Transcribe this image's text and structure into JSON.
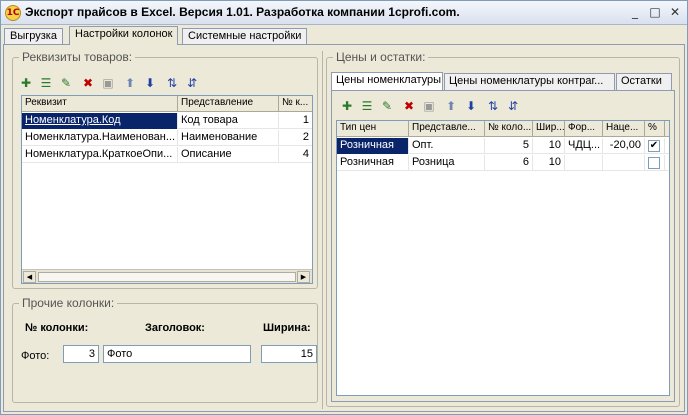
{
  "window": {
    "title": "Экспорт прайсов в Excel. Версия 1.01. Разработка компании 1cprofi.com.",
    "icon": "1c-logo-icon",
    "controls": [
      "_",
      "□",
      "✕"
    ]
  },
  "tabs": [
    {
      "label": "Выгрузка",
      "active": false
    },
    {
      "label": "Настройки колонок",
      "active": true
    },
    {
      "label": "Системные настройки",
      "active": false
    }
  ],
  "attributes_group": {
    "title": "Реквизиты товаров:",
    "toolbar": [
      "add-icon",
      "add-child-icon",
      "edit-icon",
      "delete-icon",
      "disabled-icon",
      "move-up-icon",
      "move-down-icon",
      "sort-asc-icon",
      "sort-desc-icon"
    ],
    "columns": [
      "Реквизит",
      "Представление",
      "№ к...",
      ""
    ],
    "rows": [
      {
        "attr": "Номенклатура.Код",
        "view": "Код товара",
        "num": "1",
        "selected": true
      },
      {
        "attr": "Номенклатура.Наименован...",
        "view": "Наименование",
        "num": "2",
        "selected": false
      },
      {
        "attr": "Номенклатура.КраткоеОпи...",
        "view": "Описание",
        "num": "4",
        "selected": false
      }
    ]
  },
  "other_group": {
    "title": "Прочие колонки:",
    "headers": {
      "num": "№ колонки:",
      "title": "Заголовок:",
      "width": "Ширина:"
    },
    "row": {
      "label": "Фото:",
      "num": "3",
      "title": "Фото",
      "width": "15"
    }
  },
  "prices_group": {
    "title": "Цены и остатки:",
    "tabs": [
      {
        "label": "Цены номенклатуры",
        "active": true
      },
      {
        "label": "Цены номенклатуры контраг...",
        "active": false
      },
      {
        "label": "Остатки",
        "active": false
      }
    ],
    "toolbar": [
      "add-icon",
      "add-child-icon",
      "edit-icon",
      "delete-icon",
      "disabled-icon",
      "move-up-icon",
      "move-down-icon",
      "sort-asc-icon",
      "sort-desc-icon"
    ],
    "columns": [
      "Тип цен",
      "Представле...",
      "№ коло...",
      "Шир...",
      "Фор...",
      "Наце...",
      "%"
    ],
    "rows": [
      {
        "type": "Розничная",
        "view": "Опт.",
        "num": "5",
        "width": "10",
        "format": "ЧДЦ...",
        "markup": "-20,00",
        "pct": "✔",
        "selected": true
      },
      {
        "type": "Розничная",
        "view": "Розница",
        "num": "6",
        "width": "10",
        "format": "",
        "markup": "",
        "pct": "",
        "selected": false
      }
    ]
  }
}
